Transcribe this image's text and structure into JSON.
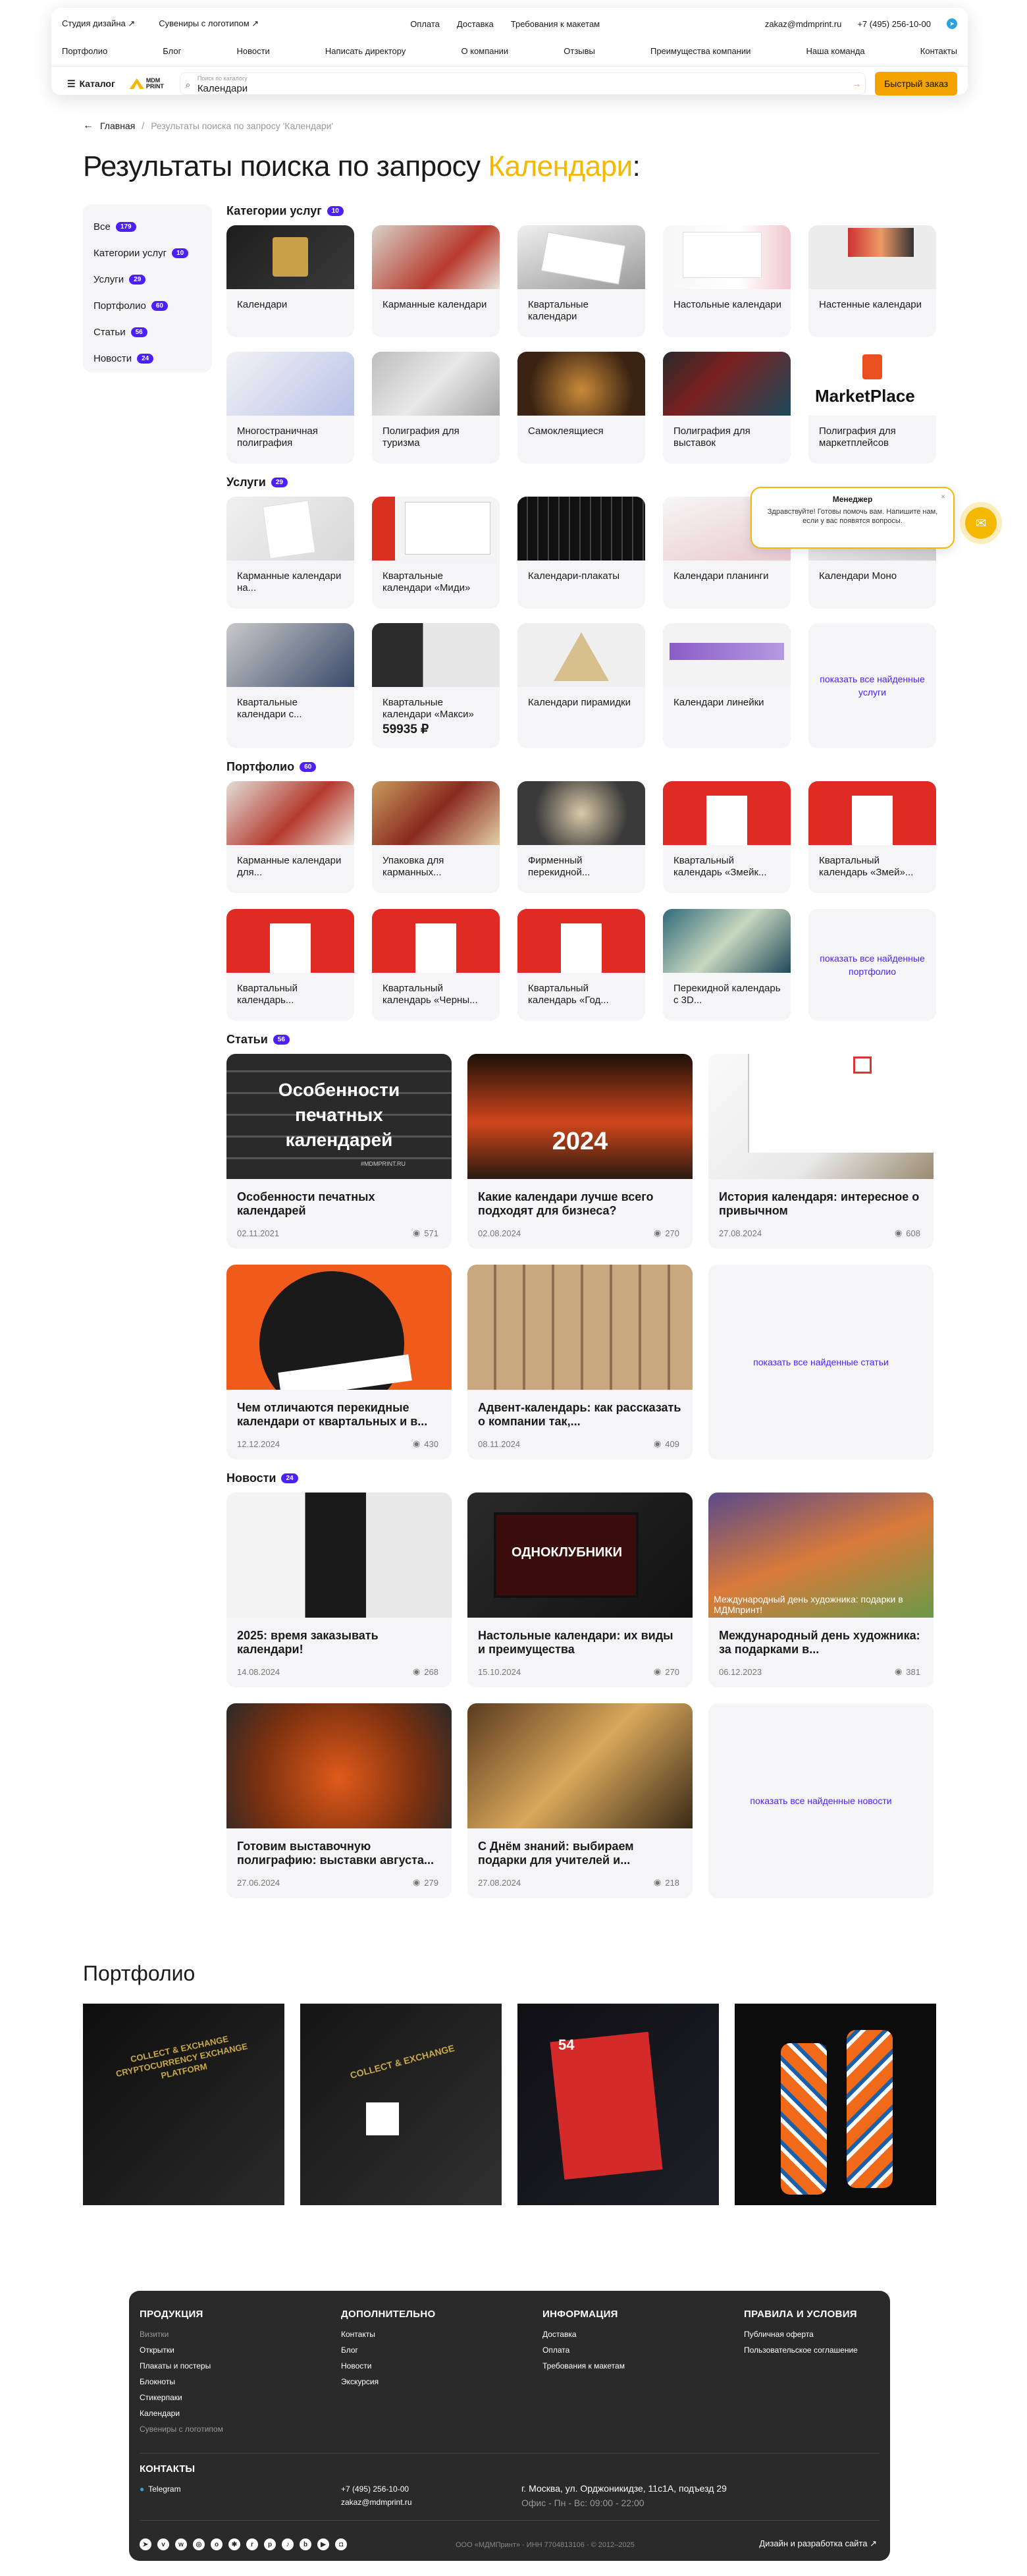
{
  "header": {
    "top_links": [
      "Студия дизайна ↗",
      "Сувениры с логотипом ↗"
    ],
    "top_center": [
      "Оплата",
      "Доставка",
      "Требования к макетам"
    ],
    "email": "zakaz@mdmprint.ru",
    "phone": "+7 (495) 256-10-00",
    "nav": [
      "Портфолио",
      "Блог",
      "Новости",
      "Написать директору",
      "О компании",
      "Отзывы",
      "Преимущества компании",
      "Наша команда",
      "Контакты"
    ],
    "catalog_label": "Каталог",
    "logo_line1": "MDM",
    "logo_line2": "PRINT",
    "search_label": "Поиск по каталогу",
    "search_value": "Календари",
    "quick_order": "Быстрый заказ"
  },
  "breadcrumb": {
    "home": "Главная",
    "sep": "/",
    "current": "Результаты поиска по запросу 'Календари'"
  },
  "title": {
    "prefix": "Результаты поиска по запросу ",
    "query": "Календари",
    "suffix": ":"
  },
  "filters": [
    {
      "label": "Все",
      "count": "179"
    },
    {
      "label": "Категории услуг",
      "count": "10"
    },
    {
      "label": "Услуги",
      "count": "29"
    },
    {
      "label": "Портфолио",
      "count": "60"
    },
    {
      "label": "Статьи",
      "count": "56"
    },
    {
      "label": "Новости",
      "count": "24"
    }
  ],
  "sections": {
    "categories": {
      "title": "Категории услуг",
      "count": "10",
      "items": [
        "Календари",
        "Карманные календари",
        "Квартальные календари",
        "Настольные календари",
        "Настенные календари",
        "Многостраничная полиграфия",
        "Полиграфия для туризма",
        "Самоклеящиеся",
        "Полиграфия для выставок",
        "Полиграфия для маркетплейсов"
      ]
    },
    "services": {
      "title": "Услуги",
      "count": "29",
      "items": [
        "Карманные календари на...",
        "Квартальные календари «Миди»",
        "Календари-плакаты",
        "Календари планинги",
        "Календари Моно",
        "Квартальные календари с...",
        "Квартальные календари «Макси»",
        "Календари пирамидки",
        "Календари линейки"
      ],
      "price": "59935 ₽",
      "more": "показать все найденные услуги"
    },
    "portfolio": {
      "title": "Портфолио",
      "count": "60",
      "items": [
        "Карманные календари для...",
        "Упаковка для карманных...",
        "Фирменный перекидной...",
        "Квартальный календарь «Змейк...",
        "Квартальный календарь «Змей»...",
        "Квартальный календарь...",
        "Квартальный календарь «Черны...",
        "Квартальный календарь «Год...",
        "Перекидной календарь с 3D..."
      ],
      "more": "показать все найденные портфолио"
    },
    "articles": {
      "title": "Статьи",
      "count": "56",
      "items": [
        {
          "title": "Особенности печатных календарей",
          "date": "02.11.2021",
          "views": "571",
          "overlay": "Особенности печатных календарей",
          "tag": "#MDMPRINT.RU"
        },
        {
          "title": "Какие календари лучше всего подходят для бизнеса?",
          "date": "02.08.2024",
          "views": "270",
          "overlay": "2024"
        },
        {
          "title": "История календаря: интересное о привычном",
          "date": "27.08.2024",
          "views": "608",
          "overlay": ""
        },
        {
          "title": "Чем отличаются перекидные календари от квартальных и в...",
          "date": "12.12.2024",
          "views": "430",
          "overlay": ""
        },
        {
          "title": "Адвент-календарь: как рассказать о компании так,...",
          "date": "08.11.2024",
          "views": "409",
          "overlay": ""
        }
      ],
      "more": "показать все найденные статьи"
    },
    "news": {
      "title": "Новости",
      "count": "24",
      "items": [
        {
          "title": "2025: время заказывать календари!",
          "date": "14.08.2024",
          "views": "268",
          "overlay": ""
        },
        {
          "title": "Настольные календари: их виды и преимущества",
          "date": "15.10.2024",
          "views": "270",
          "overlay": "ОДНОКЛУБНИКИ"
        },
        {
          "title": "Международный день художника: за подарками в...",
          "date": "06.12.2023",
          "views": "381",
          "overlay": "Международный день художника: подарки в МДМпринт!"
        },
        {
          "title": "Готовим выставочную полиграфию: выставки августа...",
          "date": "27.06.2024",
          "views": "279",
          "overlay": ""
        },
        {
          "title": "С Днём знаний: выбираем подарки для учителей и...",
          "date": "27.08.2024",
          "views": "218",
          "overlay": ""
        }
      ],
      "more": "показать все найденные новости"
    }
  },
  "portfolio_block": {
    "title": "Портфолио",
    "captions": [
      "COLLECT & EXCHANGE CRYPTOCURRENCY EXCHANGE PLATFORM",
      "COLLECT & EXCHANGE",
      "54",
      ""
    ]
  },
  "chat": {
    "name": "Менеджер",
    "message": "Здравствуйте! Готовы помочь вам. Напишите нам, если у вас появятся вопросы.",
    "close": "×"
  },
  "footer": {
    "products": {
      "title": "ПРОДУКЦИЯ",
      "items": [
        "Визитки",
        "Открытки",
        "Плакаты и постеры",
        "Блокноты",
        "Стикерпаки",
        "Календари",
        "Сувениры с логотипом"
      ]
    },
    "extra": {
      "title": "ДОПОЛНИТЕЛЬНО",
      "items": [
        "Контакты",
        "Блог",
        "Новости",
        "Экскурсия"
      ]
    },
    "info": {
      "title": "ИНФОРМАЦИЯ",
      "items": [
        "Доставка",
        "Оплата",
        "Требования к макетам"
      ]
    },
    "rules": {
      "title": "ПРАВИЛА И УСЛОВИЯ",
      "items": [
        "Публичная оферта",
        "Пользовательское соглашение"
      ]
    },
    "contacts_title": "КОНТАКТЫ",
    "telegram": "Telegram",
    "phone": "+7 (495) 256-10-00",
    "email": "zakaz@mdmprint.ru",
    "address": "г. Москва, ул. Орджоникидзе, 11с1А, подъезд 29",
    "hours": "Офис - Пн - Вс: 09:00 - 22:00",
    "legal": "ООО «МДМПринт» · ИНН 7704813106 · © 2012–2025",
    "dev": "Дизайн и разработка сайта ↗"
  }
}
